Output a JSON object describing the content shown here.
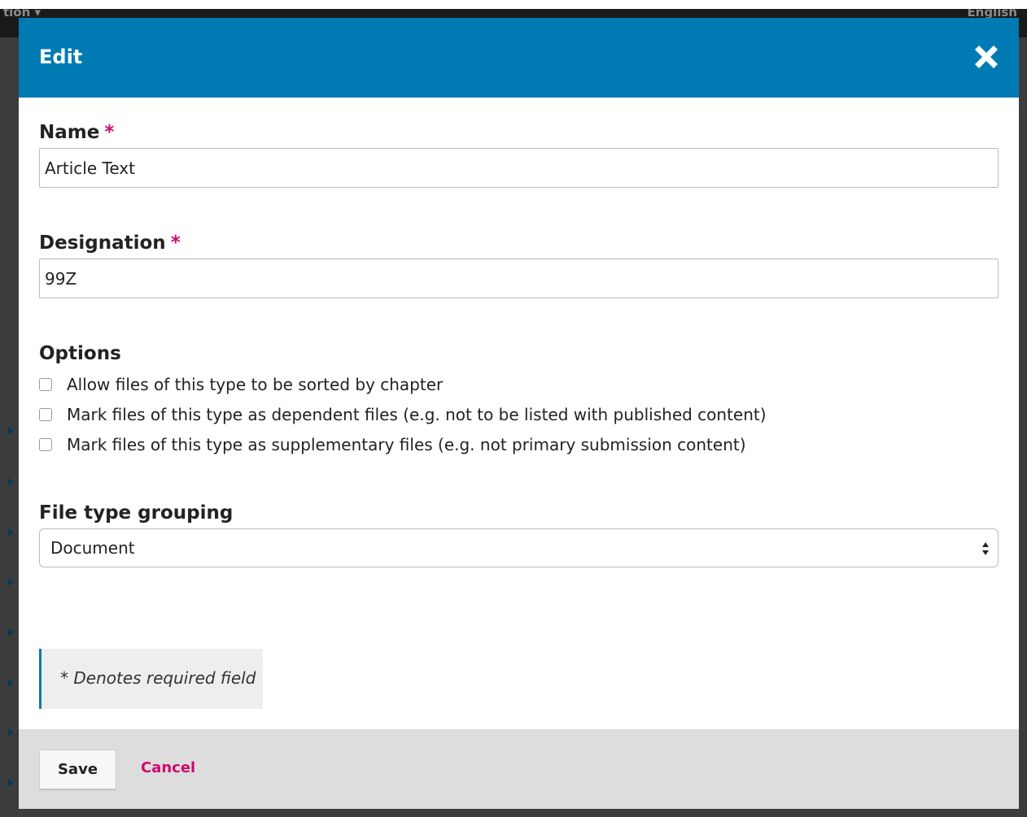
{
  "background": {
    "topbar_left": "tion ▾",
    "topbar_right": "English"
  },
  "modal": {
    "title": "Edit",
    "close_icon": "close-icon"
  },
  "form": {
    "name": {
      "label": "Name",
      "required_marker": "*",
      "value": "Article Text"
    },
    "designation": {
      "label": "Designation",
      "required_marker": "*",
      "value": "99Z"
    },
    "options": {
      "label": "Options",
      "items": [
        {
          "label": "Allow files of this type to be sorted by chapter",
          "checked": false
        },
        {
          "label": "Mark files of this type as dependent files (e.g. not to be listed with published content)",
          "checked": false
        },
        {
          "label": "Mark files of this type as supplementary files (e.g. not primary submission content)",
          "checked": false
        }
      ]
    },
    "file_type_grouping": {
      "label": "File type grouping",
      "selected": "Document"
    },
    "required_note": "* Denotes required field"
  },
  "footer": {
    "save_label": "Save",
    "cancel_label": "Cancel"
  },
  "colors": {
    "header": "#007ab2",
    "accent": "#d00a6c",
    "footer": "#dddddd"
  }
}
